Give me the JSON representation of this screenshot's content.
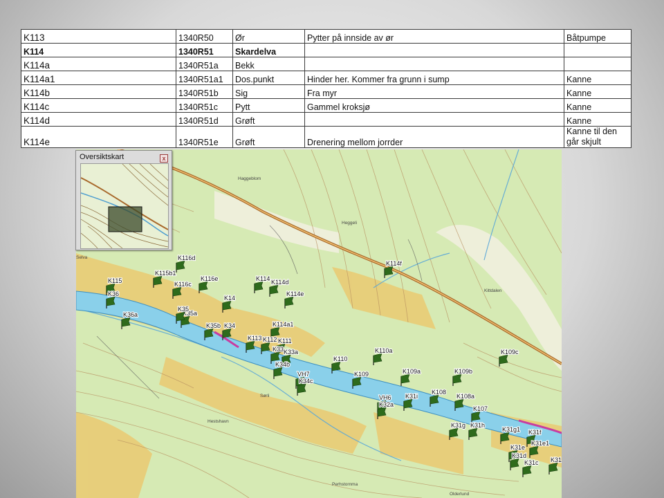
{
  "table": {
    "rows": [
      {
        "id": "K113",
        "code": "1340R50",
        "type": "Ør",
        "note": "Pytter på innside av ør",
        "measure": "Båtpumpe"
      },
      {
        "id": "K114",
        "code": "1340R51",
        "type": "Skardelva",
        "note": "",
        "measure": ""
      },
      {
        "id": "K114a",
        "code": "1340R51a",
        "type": "Bekk",
        "note": "",
        "measure": ""
      },
      {
        "id": "K114a1",
        "code": "1340R51a1",
        "type": "Dos.punkt",
        "note": "Hinder her. Kommer fra grunn i sump",
        "measure": "Kanne"
      },
      {
        "id": "K114b",
        "code": "1340R51b",
        "type": "Sig",
        "note": "Fra myr",
        "measure": "Kanne"
      },
      {
        "id": "K114c",
        "code": "1340R51c",
        "type": "Pytt",
        "note": "Gammel kroksjø",
        "measure": "Kanne"
      },
      {
        "id": "K114d",
        "code": "1340R51d",
        "type": "Grøft",
        "note": "",
        "measure": "Kanne"
      },
      {
        "id": "K114e",
        "code": "1340R51e",
        "type": "Grøft",
        "note": "Drenering mellom jorrder",
        "measure": "Kanne til den går skjult"
      }
    ]
  },
  "overview": {
    "title": "Oversiktskart",
    "close_glyph": "x",
    "close_icon": "close-icon"
  },
  "map": {
    "places": [
      "Haggeblom",
      "Heggeli",
      "Kittdalen",
      "Hestshavn",
      "Olderlund",
      "Perhstornma",
      "Selva",
      "Sørli"
    ],
    "flags": [
      "K116d",
      "K115b1",
      "K115",
      "K116c",
      "K116e",
      "K114",
      "K114d",
      "K114e",
      "K36",
      "K35a",
      "K35",
      "K14",
      "K36a",
      "K114a1",
      "K35b",
      "K34",
      "K114f",
      "K113",
      "K112",
      "K111",
      "K33",
      "K33a",
      "K34b",
      "K110",
      "K110a",
      "K109c",
      "VH7",
      "K34c",
      "K109",
      "K109a",
      "K109b",
      "VH6",
      "K32a",
      "K31i",
      "K108",
      "K108a",
      "K107",
      "K31g",
      "K31h",
      "K31g1",
      "K31f",
      "K31e1",
      "K31e",
      "K31d",
      "K31c",
      "K31"
    ],
    "colors": {
      "flag": "#2e6b1c",
      "river": "#7ec9e3",
      "road": "#b2773a",
      "field": "#e7cc7a",
      "forest": "#d4e9b1"
    }
  }
}
